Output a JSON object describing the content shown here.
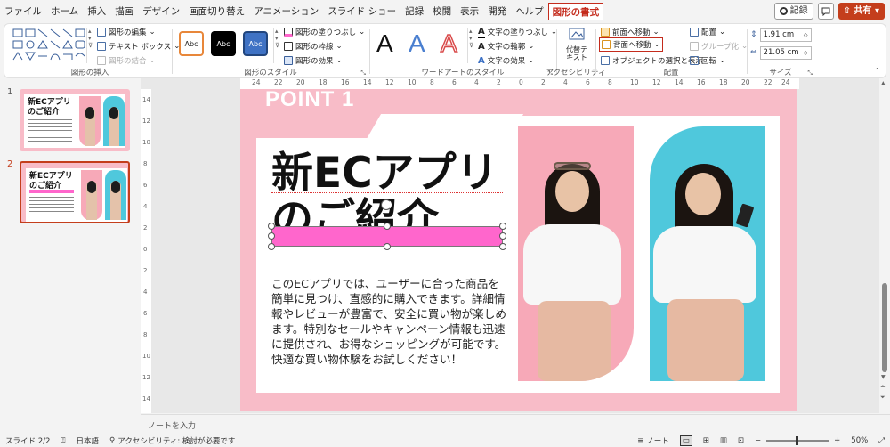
{
  "menu": {
    "tabs": [
      "ファイル",
      "ホーム",
      "挿入",
      "描画",
      "デザイン",
      "画面切り替え",
      "アニメーション",
      "スライド ショー",
      "記録",
      "校閲",
      "表示",
      "開発",
      "ヘルプ",
      "図形の書式"
    ],
    "record": "記録",
    "share": "共有"
  },
  "ribbon": {
    "insert_shapes": {
      "label": "図形の挿入",
      "edit_shape": "図形の編集",
      "text_box": "テキスト ボックス",
      "merge_shapes": "図形の結合"
    },
    "shape_styles": {
      "label": "図形のスタイル",
      "preset": "Abc",
      "fill": "図形の塗りつぶし",
      "outline": "図形の枠線",
      "effects": "図形の効果"
    },
    "wordart": {
      "label": "ワードアートのスタイル",
      "letter": "A",
      "text_fill": "文字の塗りつぶし",
      "text_outline": "文字の輪郭",
      "text_effects": "文字の効果"
    },
    "accessibility": {
      "label": "アクセシビリティ",
      "alt_text": "代替テキスト"
    },
    "arrange": {
      "label": "配置",
      "bring_forward": "前面へ移動",
      "send_backward": "背面へ移動",
      "selection_pane": "オブジェクトの選択と表示",
      "align": "配置",
      "group": "グループ化",
      "rotate": "回転"
    },
    "size": {
      "label": "サイズ",
      "height": "1.91 cm",
      "width": "21.05 cm"
    }
  },
  "thumbnails": [
    {
      "num": "1",
      "title": "新ECアプリのご紹介"
    },
    {
      "num": "2",
      "title": "新ECアプリのご紹介"
    }
  ],
  "ruler": {
    "top": [
      "24",
      "22",
      "20",
      "18",
      "16",
      "14",
      "12",
      "10",
      "8",
      "6",
      "4",
      "2",
      "0",
      "2",
      "4",
      "6",
      "8",
      "10",
      "12",
      "14",
      "16",
      "18",
      "20",
      "22",
      "24"
    ],
    "left": [
      "14",
      "12",
      "10",
      "8",
      "6",
      "4",
      "2",
      "0",
      "2",
      "4",
      "6",
      "8",
      "10",
      "12",
      "14"
    ]
  },
  "slide": {
    "point": "POINT 1",
    "title_line1": "新ECアプリ",
    "title_line2": "のご紹介",
    "body": "このECアプリでは、ユーザーに合った商品を簡単に見つけ、直感的に購入できます。詳細情報やレビューが豊富で、安全に買い物が楽しめます。特別なセールやキャンペーン情報も迅速に提供され、お得なショッピングが可能です。快適な買い物体験をお試しください！"
  },
  "notes": {
    "placeholder": "ノートを入力"
  },
  "status": {
    "slide": "スライド 2/2",
    "language": "日本語",
    "accessibility": "アクセシビリティ: 検討が必要です",
    "notes": "ノート",
    "zoom": "50%"
  },
  "colors": {
    "accent": "#c43e1c",
    "slide_bg": "#f8bcc8",
    "highlight": "#ff66cc",
    "photo1": "#f7a9b8",
    "photo2": "#4fc8dc"
  }
}
